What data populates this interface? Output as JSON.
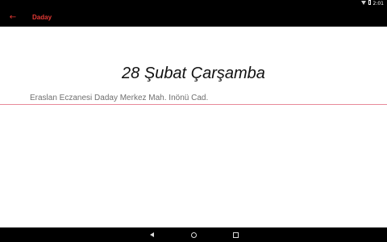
{
  "status_bar": {
    "time": "2:01",
    "icons": [
      "wifi-icon",
      "battery-icon"
    ]
  },
  "app_bar": {
    "back_icon": "arrow-back-icon",
    "title": "Daday",
    "accent_color": "#e53935"
  },
  "content": {
    "date": "28 Şubat Çarşamba",
    "pharmacy": "Eraslan Eczanesi Daday Merkez Mah. Inönü Cad.",
    "divider_color": "#e88a9a"
  },
  "nav_bar": {
    "icons": [
      "nav-back-icon",
      "nav-home-icon",
      "nav-recents-icon"
    ]
  }
}
